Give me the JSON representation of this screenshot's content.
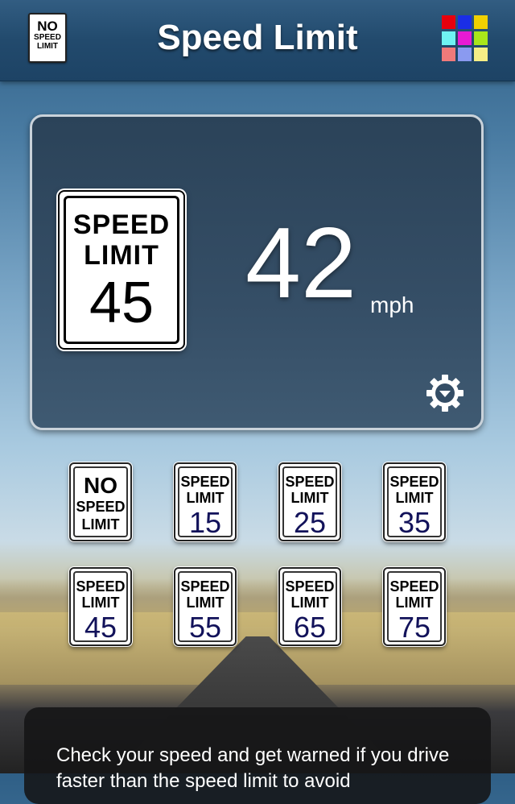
{
  "header": {
    "title": "Speed Limit",
    "no_limit_icon": {
      "line1": "NO",
      "line2": "SPEED",
      "line3": "LIMIT"
    },
    "color_grid": [
      "#e8000c",
      "#1a2ee6",
      "#f0d000",
      "#6ff3f3",
      "#e81ad4",
      "#a9e61a",
      "#f07a7a",
      "#8a9af0",
      "#f6ee86"
    ]
  },
  "current": {
    "limit_sign": {
      "line1": "SPEED",
      "line2": "LIMIT",
      "value": "45"
    },
    "speed": "42",
    "unit": "mph",
    "settings_icon": "gear-icon"
  },
  "sign_buttons": [
    {
      "line1": "NO",
      "line2": "SPEED",
      "line3": "LIMIT"
    },
    {
      "line1": "SPEED",
      "line2": "LIMIT",
      "value": "15"
    },
    {
      "line1": "SPEED",
      "line2": "LIMIT",
      "value": "25"
    },
    {
      "line1": "SPEED",
      "line2": "LIMIT",
      "value": "35"
    },
    {
      "line1": "SPEED",
      "line2": "LIMIT",
      "value": "45"
    },
    {
      "line1": "SPEED",
      "line2": "LIMIT",
      "value": "55"
    },
    {
      "line1": "SPEED",
      "line2": "LIMIT",
      "value": "65"
    },
    {
      "line1": "SPEED",
      "line2": "LIMIT",
      "value": "75"
    }
  ],
  "description": "Check your speed and get warned if you drive faster than the speed limit to avoid"
}
